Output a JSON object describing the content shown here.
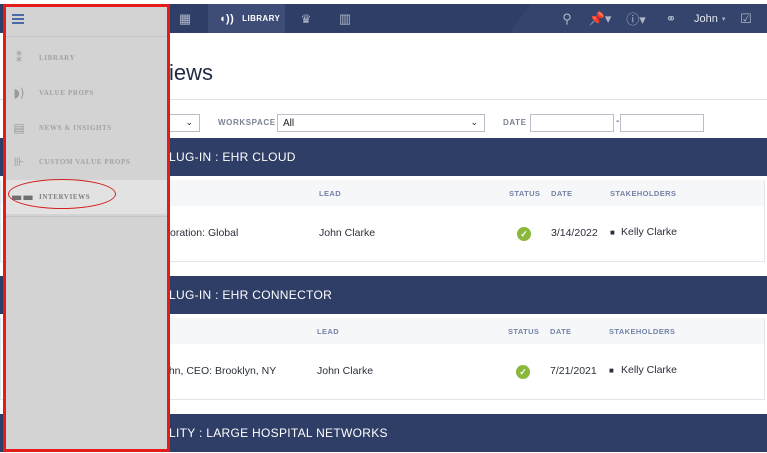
{
  "topbar": {
    "library_label": "LIBRARY",
    "user_name": "John",
    "icons": [
      "grid-icon",
      "audio-icon",
      "crown-icon",
      "bar-chart-icon",
      "search-icon",
      "pin-icon",
      "help-icon",
      "handshake-icon",
      "checkbox-icon"
    ]
  },
  "page": {
    "title_fragment": "iews"
  },
  "filters": {
    "workspace_label": "WORKSPACE",
    "workspace_value": "All",
    "date_label": "DATE",
    "date_separator": "-"
  },
  "columns": {
    "lead": "LEAD",
    "status": "STATUS",
    "date": "DATE",
    "stakeholders": "STAKEHOLDERS"
  },
  "groups": [
    {
      "title": "LUG-IN : EHR CLOUD",
      "rows": [
        {
          "name": "oration: Global",
          "lead": "John Clarke",
          "status": "complete",
          "date": "3/14/2022",
          "stakeholder": "Kelly Clarke"
        }
      ]
    },
    {
      "title": "LUG-IN : EHR CONNECTOR",
      "rows": [
        {
          "name": "ghn, CEO: Brooklyn, NY",
          "lead": "John Clarke",
          "status": "complete",
          "date": "7/21/2021",
          "stakeholder": "Kelly Clarke"
        }
      ]
    },
    {
      "title": "LITY : LARGE HOSPITAL NETWORKS",
      "rows": []
    }
  ],
  "sidebar": {
    "items": [
      {
        "label": "LIBRARY",
        "icon": "library-icon"
      },
      {
        "label": "VALUE PROPS",
        "icon": "value-props-icon"
      },
      {
        "label": "NEWS & INSIGHTS",
        "icon": "news-icon"
      },
      {
        "label": "CUSTOM VALUE PROPS",
        "icon": "custom-value-props-icon"
      },
      {
        "label": "INTERVIEWS",
        "icon": "interviews-icon",
        "active": true
      }
    ]
  },
  "colors": {
    "navy": "#2f3e66",
    "status_ok": "#8ab83a",
    "highlight_red": "#e31b1b",
    "sidebar_bg": "#d3d3d3"
  }
}
